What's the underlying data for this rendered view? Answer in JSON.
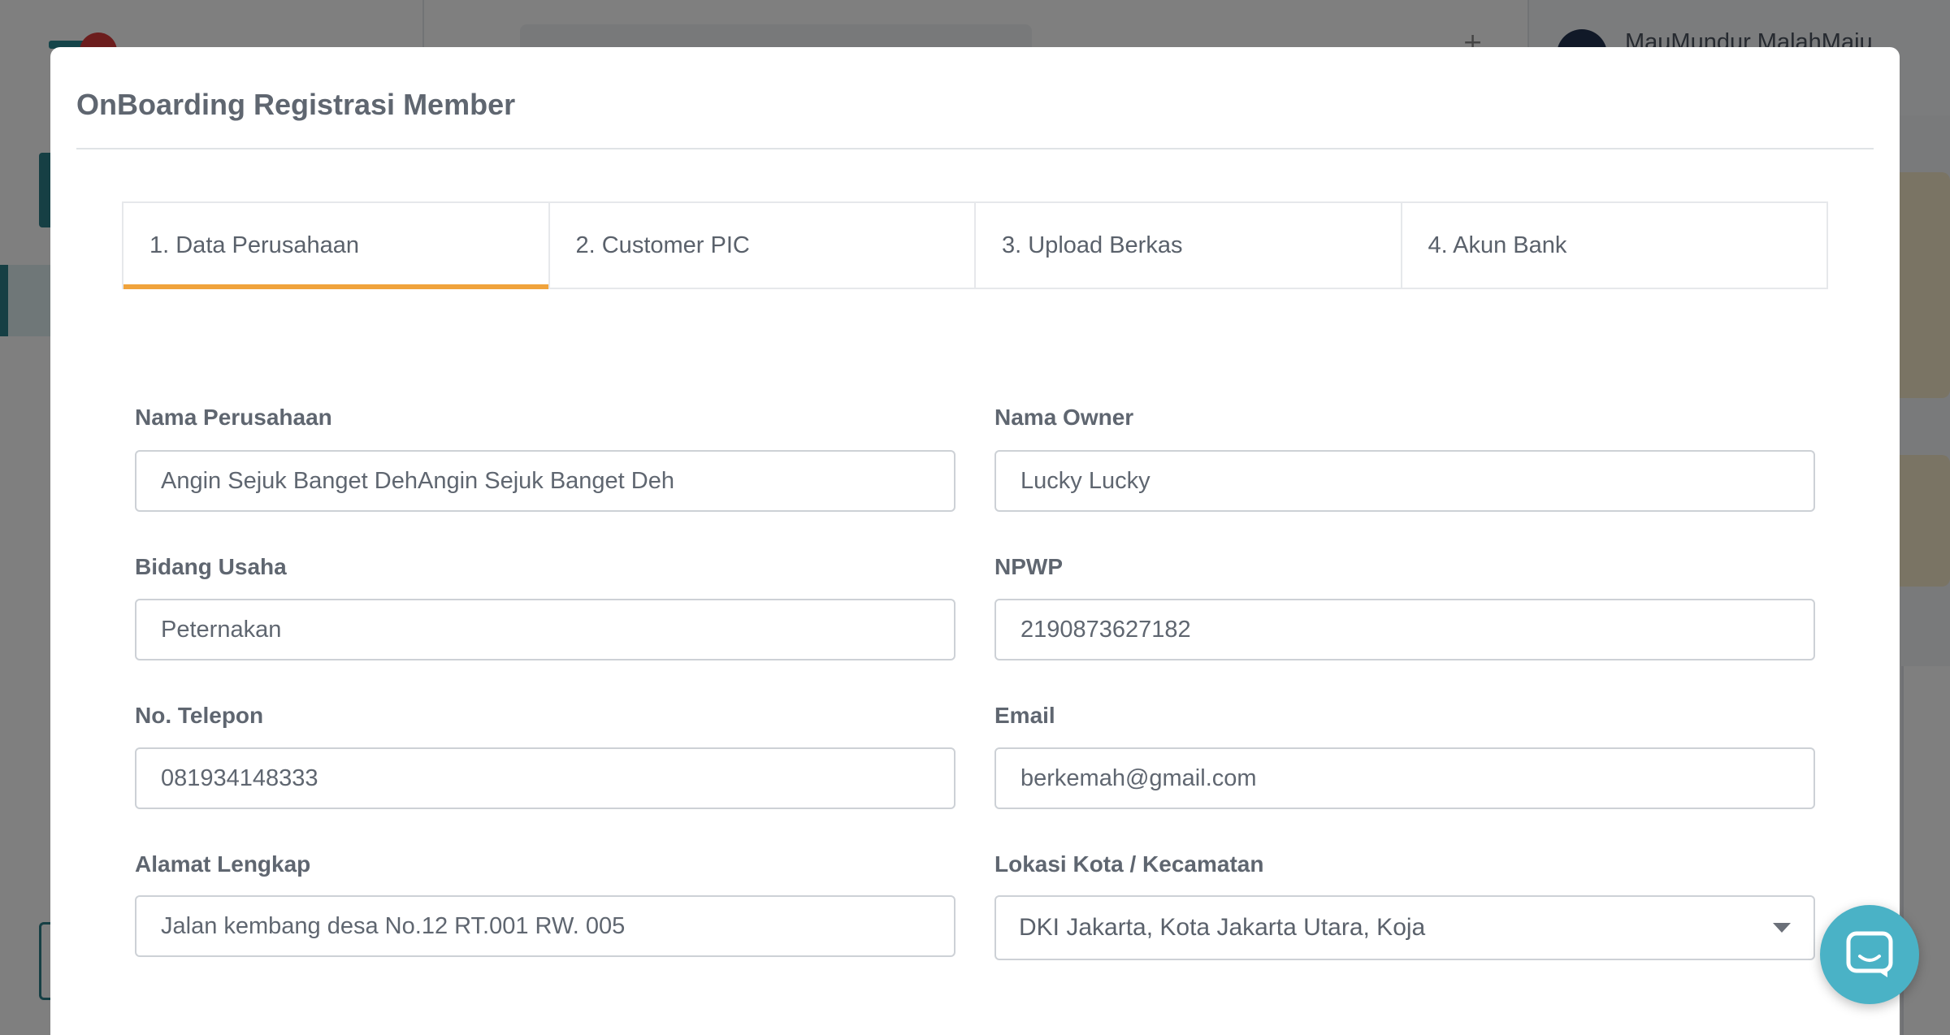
{
  "background": {
    "user_name": "MauMundur MalahMaju"
  },
  "modal": {
    "title": "OnBoarding Registrasi Member",
    "tabs": [
      {
        "label": "1. Data Perusahaan",
        "active": true
      },
      {
        "label": "2. Customer PIC",
        "active": false
      },
      {
        "label": "3. Upload Berkas",
        "active": false
      },
      {
        "label": "4. Akun Bank",
        "active": false
      }
    ],
    "form": {
      "nama_perusahaan": {
        "label": "Nama Perusahaan",
        "value": "Angin Sejuk Banget DehAngin Sejuk Banget Deh"
      },
      "nama_owner": {
        "label": "Nama Owner",
        "value": "Lucky Lucky"
      },
      "bidang_usaha": {
        "label": "Bidang Usaha",
        "value": "Peternakan"
      },
      "npwp": {
        "label": "NPWP",
        "value": "2190873627182"
      },
      "no_telepon": {
        "label": "No. Telepon",
        "value": "081934148333"
      },
      "email": {
        "label": "Email",
        "value": "berkemah@gmail.com"
      },
      "alamat": {
        "label": "Alamat Lengkap",
        "value": "Jalan kembang desa No.12 RT.001 RW. 005"
      },
      "lokasi": {
        "label": "Lokasi Kota / Kecamatan",
        "value": "DKI Jakarta, Kota Jakarta Utara, Koja"
      }
    }
  },
  "colors": {
    "accent_tab": "#f0a33c",
    "chat_button": "#4ab2c6",
    "brand_teal": "#2c7f88"
  },
  "icons": {
    "chat": "chat-bubble-icon",
    "dropdown": "chevron-down-icon"
  }
}
